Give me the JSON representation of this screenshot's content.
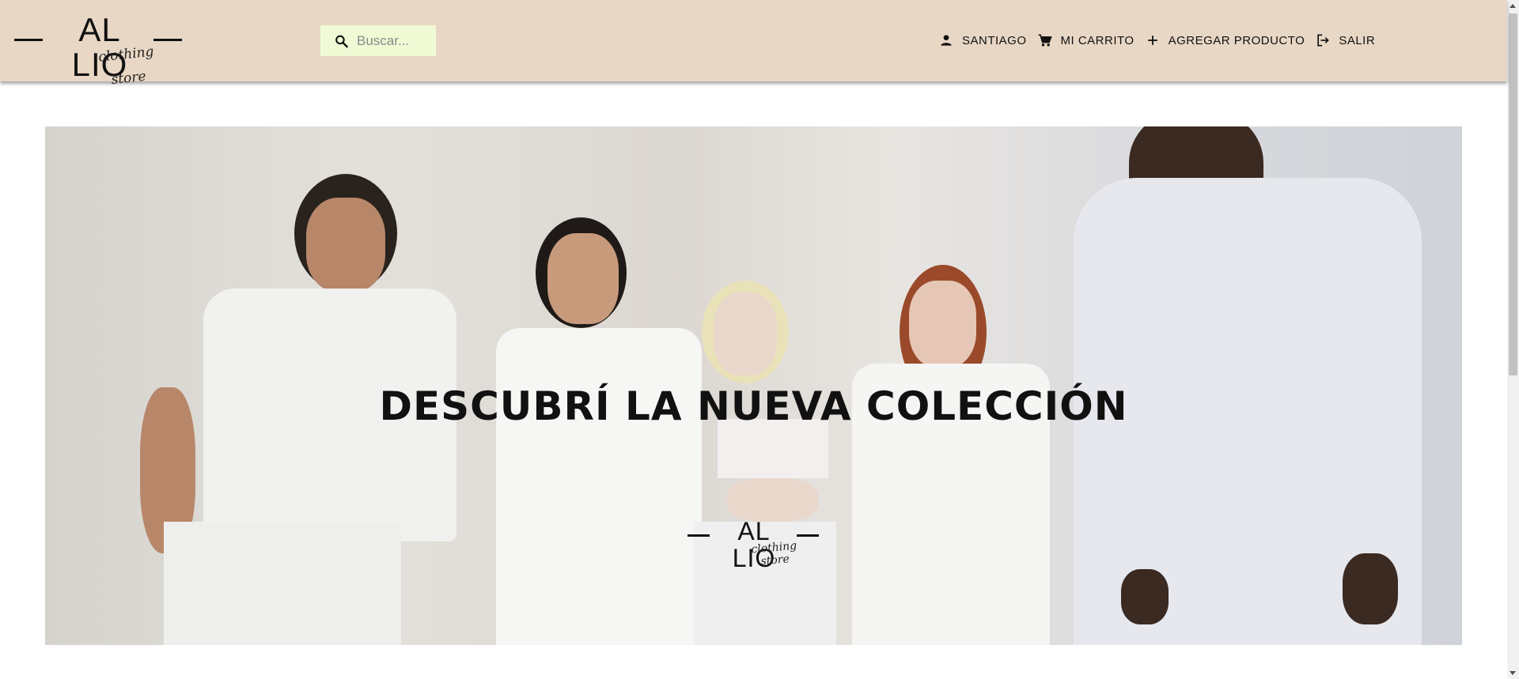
{
  "header": {
    "brand": {
      "name": "AL LIO",
      "tagline": "clothing store"
    },
    "search": {
      "placeholder": "Buscar..."
    },
    "nav": [
      {
        "label": "SANTIAGO",
        "icon": "person-icon"
      },
      {
        "label": "MI CARRITO",
        "icon": "cart-icon"
      },
      {
        "label": "AGREGAR PRODUCTO",
        "icon": "plus-icon"
      },
      {
        "label": "SALIR",
        "icon": "logout-icon"
      }
    ]
  },
  "hero": {
    "title": "DESCUBRÍ LA NUEVA COLECCIÓN",
    "logo": {
      "name": "AL LIO",
      "tagline": "clothing store"
    }
  },
  "colors": {
    "header_bg": "#e8d7c4",
    "search_bg": "#f0fad5",
    "text": "#111111"
  }
}
